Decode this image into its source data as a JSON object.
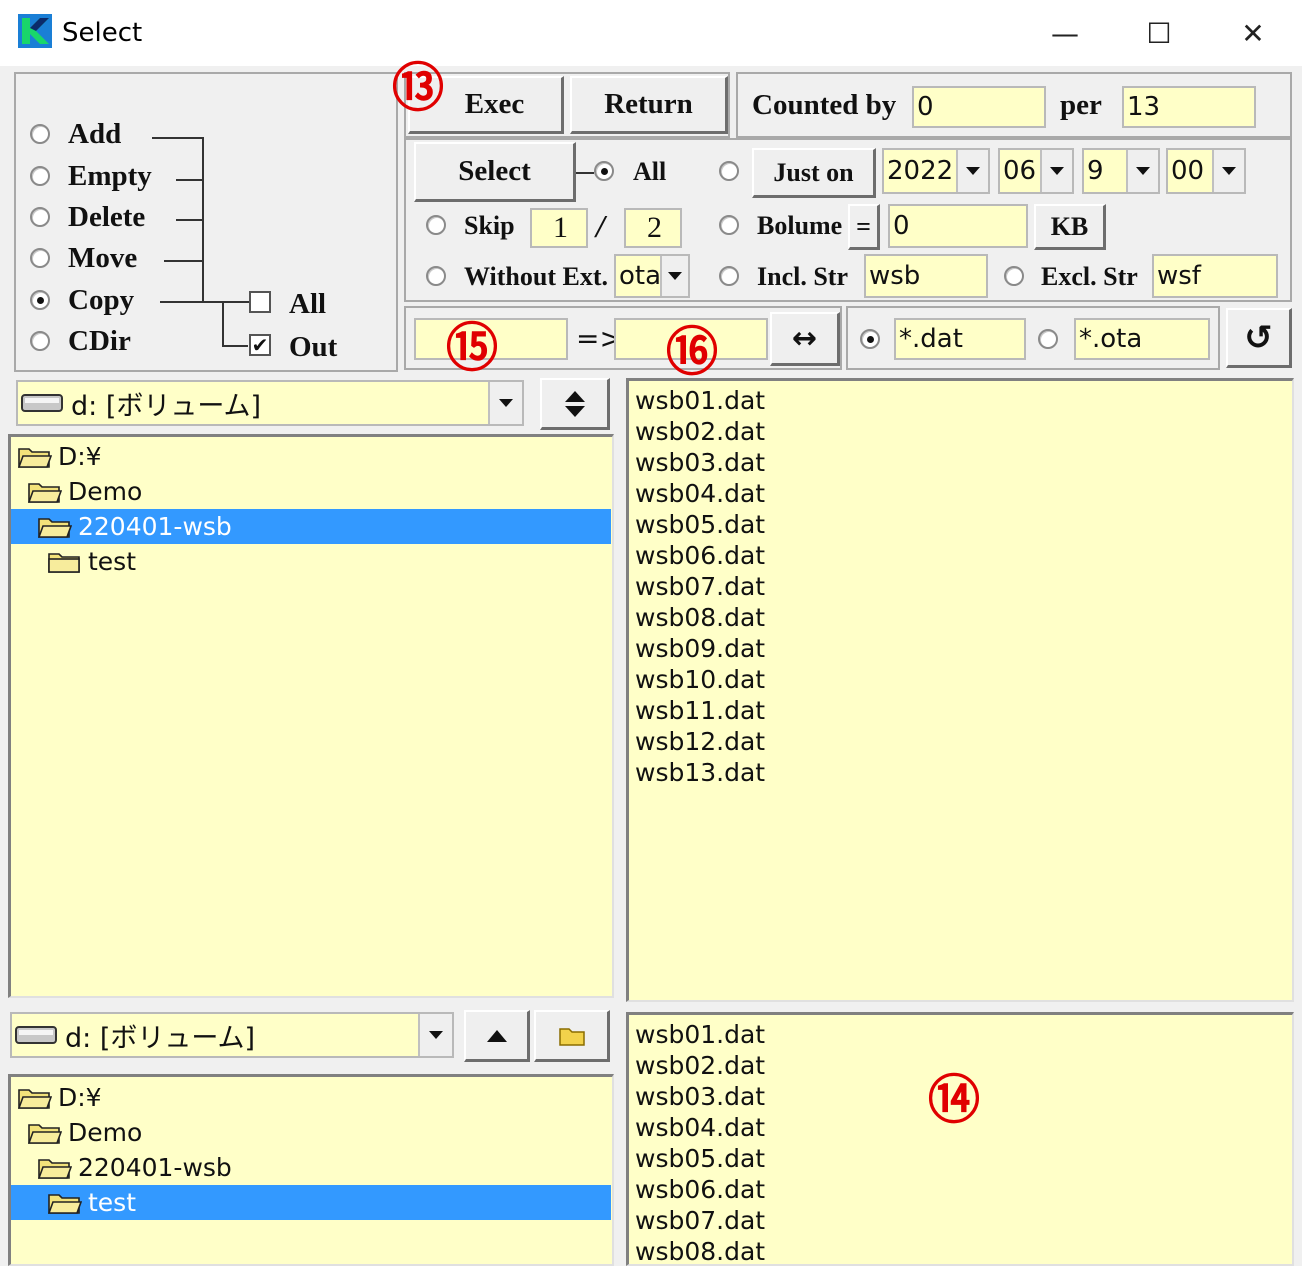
{
  "window": {
    "title": "Select",
    "controls": {
      "minimize": "—",
      "maximize": "☐",
      "close": "✕"
    }
  },
  "operations": {
    "options": [
      "Add",
      "Empty",
      "Delete",
      "Move",
      "Copy",
      "CDir"
    ],
    "selected": "Copy",
    "copy_options": [
      {
        "label": "All",
        "checked": false
      },
      {
        "label": "Out",
        "checked": true
      }
    ]
  },
  "toolbar": {
    "exec_label": "Exec",
    "return_label": "Return",
    "counted_by_label": "Counted by",
    "counted_by_value": "0",
    "per_label": "per",
    "per_value": "13"
  },
  "select_panel": {
    "select_label": "Select",
    "all_label": "All",
    "just_on_label": "Just on",
    "year": "2022",
    "month": "06",
    "day": "9",
    "hour": "00",
    "skip_label": "Skip",
    "skip_a": "1",
    "skip_sep": "/",
    "skip_b": "2",
    "bolume_label": "Bolume",
    "eq_label": "=",
    "bolume_value": "0",
    "kb_label": "KB",
    "without_ext_label": "Without Ext.",
    "without_ext_value": "ota",
    "incl_label": "Incl. Str",
    "incl_value": "wsb",
    "excl_label": "Excl. Str",
    "excl_value": "wsf"
  },
  "rename": {
    "from_value": "",
    "arrow": "=>",
    "to_value": "",
    "swap_label": "↔",
    "filter1": "*.dat",
    "filter2": "*.ota",
    "refresh_label": "↺"
  },
  "source": {
    "drive": "d: [ボリューム]",
    "tree": [
      "D:¥",
      "Demo",
      "220401-wsb",
      "test"
    ],
    "selected_folder": "220401-wsb",
    "files": [
      "wsb01.dat",
      "wsb02.dat",
      "wsb03.dat",
      "wsb04.dat",
      "wsb05.dat",
      "wsb06.dat",
      "wsb07.dat",
      "wsb08.dat",
      "wsb09.dat",
      "wsb10.dat",
      "wsb11.dat",
      "wsb12.dat",
      "wsb13.dat"
    ]
  },
  "destination": {
    "drive": "d: [ボリューム]",
    "tree": [
      "D:¥",
      "Demo",
      "220401-wsb",
      "test"
    ],
    "selected_folder": "test",
    "files": [
      "wsb01.dat",
      "wsb02.dat",
      "wsb03.dat",
      "wsb04.dat",
      "wsb05.dat",
      "wsb06.dat",
      "wsb07.dat",
      "wsb08.dat"
    ]
  },
  "annotations": [
    "⑬",
    "⑭",
    "⑮",
    "⑯"
  ],
  "colors": {
    "field_bg": "#ffffc8",
    "selection": "#3399ff",
    "annotation": "#e00000"
  }
}
